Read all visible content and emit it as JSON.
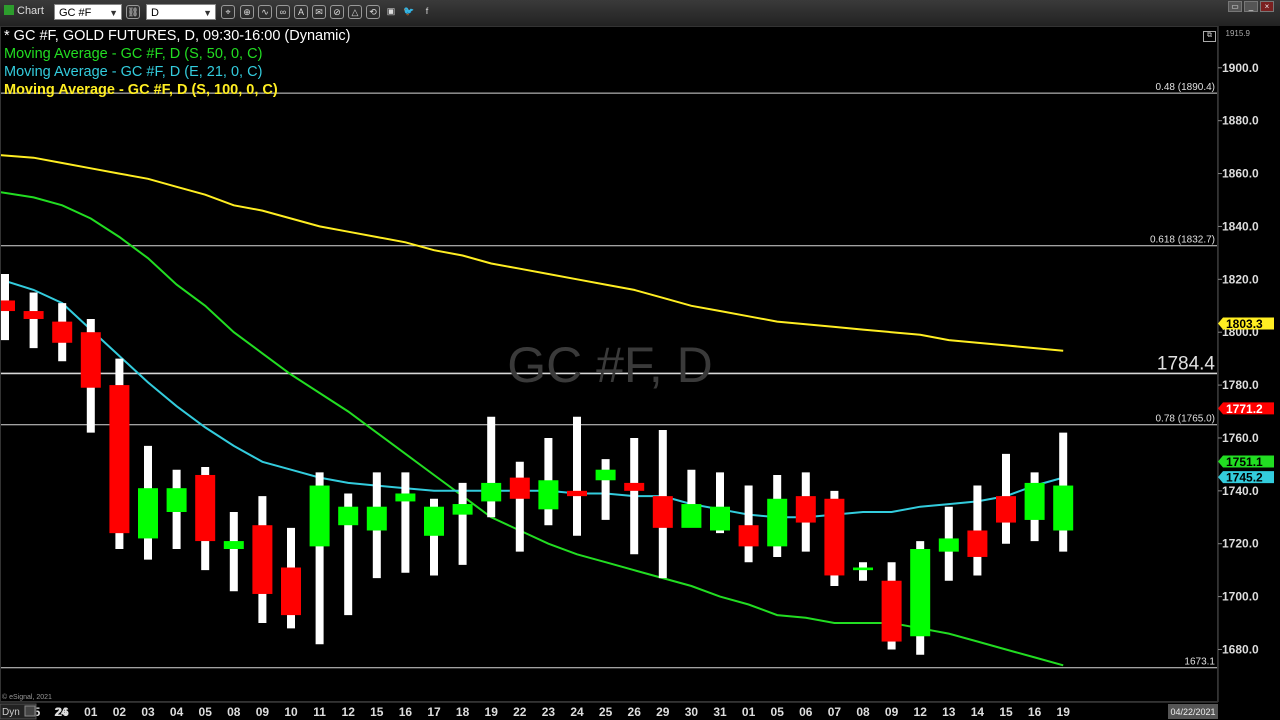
{
  "toolbar": {
    "app_title": "Chart",
    "symbol": "GC #F",
    "interval": "D",
    "tools": [
      "crosshair-icon",
      "zoom-icon",
      "draw-icon",
      "link-icon",
      "text-icon",
      "alert-icon",
      "fib-icon",
      "pattern-icon",
      "share-icon",
      "twitter-icon",
      "facebook-icon"
    ],
    "window_buttons": [
      "restore-icon",
      "minimize-icon",
      "close-icon"
    ]
  },
  "legend": [
    {
      "text": "* GC #F, GOLD FUTURES, D, 09:30-16:00 (Dynamic)",
      "color": "#ffffff",
      "bold": false
    },
    {
      "text": "Moving Average - GC #F, D (S, 50, 0, C)",
      "color": "#22dd22",
      "bold": false
    },
    {
      "text": "Moving Average - GC #F, D (E, 21, 0, C)",
      "color": "#33ccdd",
      "bold": false
    },
    {
      "text": "Moving Average - GC #F, D (S, 100, 0, C)",
      "color": "#ffee22",
      "bold": true
    }
  ],
  "watermark": "GC #F, D",
  "copyright": "© eSignal, 2021",
  "bottom_left_label": "Dyn",
  "date_label": "04/22/2021",
  "top_price_label": "1915.9",
  "colors": {
    "up": "#00ff00",
    "down": "#ff0000",
    "ma50": "#22dd22",
    "ma21": "#33ccdd",
    "ma100": "#ffee22"
  },
  "chart_data": {
    "type": "candlestick",
    "title": "GC #F, GOLD FUTURES, D",
    "categories": [
      "24",
      "25",
      "26",
      "01",
      "02",
      "03",
      "04",
      "05",
      "08",
      "09",
      "10",
      "11",
      "12",
      "15",
      "16",
      "17",
      "18",
      "19",
      "22",
      "23",
      "24",
      "25",
      "26",
      "29",
      "30",
      "31",
      "01",
      "05",
      "06",
      "07",
      "08",
      "09",
      "12",
      "13",
      "14",
      "15",
      "16",
      "19"
    ],
    "x_labels": [
      "24",
      "25",
      "26",
      "01",
      "02",
      "03",
      "04",
      "05",
      "08",
      "09",
      "10",
      "11",
      "12",
      "15",
      "16",
      "17",
      "18",
      "19",
      "22",
      "23",
      "24",
      "25",
      "26",
      "29",
      "30",
      "31",
      "01",
      "05",
      "06",
      "07",
      "08",
      "09",
      "12",
      "13",
      "14",
      "15",
      "16",
      "19"
    ],
    "ohlc": [
      [
        1812,
        1808,
        1822,
        1797
      ],
      [
        1808,
        1805,
        1815,
        1794
      ],
      [
        1804,
        1796,
        1811,
        1789
      ],
      [
        1800,
        1779,
        1805,
        1762
      ],
      [
        1780,
        1724,
        1790,
        1718
      ],
      [
        1722,
        1741,
        1757,
        1714
      ],
      [
        1732,
        1741,
        1748,
        1718
      ],
      [
        1746,
        1721,
        1749,
        1710
      ],
      [
        1718,
        1721,
        1732,
        1702
      ],
      [
        1727,
        1701,
        1738,
        1690
      ],
      [
        1711,
        1693,
        1726,
        1688
      ],
      [
        1719,
        1742,
        1747,
        1682
      ],
      [
        1727,
        1734,
        1739,
        1693
      ],
      [
        1725,
        1734,
        1747,
        1707
      ],
      [
        1736,
        1739,
        1747,
        1709
      ],
      [
        1723,
        1734,
        1737,
        1708
      ],
      [
        1731,
        1735,
        1743,
        1712
      ],
      [
        1736,
        1743,
        1768,
        1730
      ],
      [
        1745,
        1737,
        1751,
        1717
      ],
      [
        1733,
        1744,
        1760,
        1727
      ],
      [
        1740,
        1738,
        1768,
        1723
      ],
      [
        1744,
        1748,
        1752,
        1729
      ],
      [
        1743,
        1740,
        1760,
        1716
      ],
      [
        1738,
        1726,
        1763,
        1707
      ],
      [
        1726,
        1735,
        1748,
        1728
      ],
      [
        1725,
        1734,
        1747,
        1724
      ],
      [
        1727,
        1719,
        1742,
        1713
      ],
      [
        1719,
        1737,
        1746,
        1715
      ],
      [
        1738,
        1728,
        1747,
        1717
      ],
      [
        1737,
        1708,
        1740,
        1704
      ],
      [
        1710,
        1711,
        1713,
        1706
      ],
      [
        1706,
        1683,
        1713,
        1680
      ],
      [
        1685,
        1718,
        1721,
        1678
      ],
      [
        1717,
        1722,
        1734,
        1706
      ],
      [
        1725,
        1715,
        1742,
        1708
      ],
      [
        1738,
        1728,
        1754,
        1720
      ],
      [
        1729,
        1743,
        1747,
        1721
      ],
      [
        1725,
        1742,
        1762,
        1717
      ]
    ],
    "series": [
      {
        "name": "Moving Average - GC #F, D (S, 50, 0, C)",
        "values": [
          1853,
          1851,
          1848,
          1843,
          1836,
          1828,
          1818,
          1810,
          1800,
          1792,
          1784,
          1777,
          1770,
          1762,
          1754,
          1746,
          1738,
          1730,
          1725,
          1720,
          1716,
          1713,
          1710,
          1707,
          1704,
          1700,
          1697,
          1693,
          1692,
          1690,
          1690,
          1690,
          1688,
          1686,
          1683,
          1680,
          1677,
          1674
        ]
      },
      {
        "name": "Moving Average - GC #F, D (E, 21, 0, C)",
        "values": [
          1820,
          1816,
          1811,
          1801,
          1791,
          1781,
          1772,
          1764,
          1757,
          1751,
          1748,
          1745,
          1743,
          1742,
          1741,
          1740,
          1740,
          1740,
          1740,
          1740,
          1739,
          1739,
          1738,
          1738,
          1735,
          1733,
          1731,
          1730,
          1730,
          1731,
          1732,
          1732,
          1734,
          1735,
          1736,
          1738,
          1742,
          1745
        ]
      },
      {
        "name": "Moving Average - GC #F, D (S, 100, 0, C)",
        "values": [
          1867,
          1866,
          1864,
          1862,
          1860,
          1858,
          1855,
          1852,
          1848,
          1846,
          1843,
          1840,
          1838,
          1836,
          1834,
          1831,
          1829,
          1826,
          1824,
          1822,
          1820,
          1818,
          1816,
          1813,
          1810,
          1808,
          1806,
          1804,
          1803,
          1802,
          1801,
          1800,
          1799,
          1797,
          1796,
          1795,
          1794,
          1793
        ]
      }
    ],
    "y_ticks": [
      1680,
      1700,
      1720,
      1740,
      1760,
      1780,
      1800,
      1820,
      1840,
      1860,
      1880,
      1900
    ],
    "ylim": [
      1665,
      1915.9
    ],
    "horizontal_lines": [
      {
        "value": 1890.4,
        "label": "0.48 (1890.4)"
      },
      {
        "value": 1832.7,
        "label": "0.618 (1832.7)"
      },
      {
        "value": 1784.4,
        "label": "1784.4"
      },
      {
        "value": 1765.0,
        "label": "0.78 (1765.0)"
      },
      {
        "value": 1673.1,
        "label": "1673.1"
      }
    ],
    "price_tags": [
      {
        "value": 1803.3,
        "label": "1803.3",
        "bg": "#ffee22",
        "fg": "#000000"
      },
      {
        "value": 1771.2,
        "label": "1771.2",
        "bg": "#ff0000",
        "fg": "#ffffff"
      },
      {
        "value": 1751.1,
        "label": "1751.1",
        "bg": "#22dd22",
        "fg": "#000000"
      },
      {
        "value": 1745.2,
        "label": "1745.2",
        "bg": "#33ccdd",
        "fg": "#000000"
      }
    ],
    "grid": false,
    "legend_position": "top-left"
  }
}
